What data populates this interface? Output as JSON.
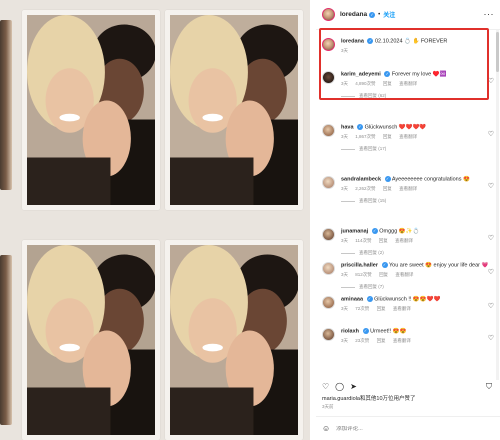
{
  "post": {
    "username": "loredana",
    "follow_label": "关注",
    "more_label": "···"
  },
  "caption": {
    "username": "loredana",
    "date": "02.10.2024",
    "text": "💍 ✋ FOREVER",
    "time": "3天"
  },
  "comments": [
    {
      "username": "karim_adeyemi",
      "text": "Forever my love ♥️♾️",
      "time": "3天",
      "likes": "4,890次赞",
      "reply": "回复",
      "translate": "查看翻译",
      "view_replies": "查看回复 (62)",
      "avatar": "b"
    },
    {
      "username": "hava",
      "text": "Glückwunsch ❤️❤️❤️❤️",
      "time": "3天",
      "likes": "1,867次赞",
      "reply": "回复",
      "translate": "查看翻译",
      "view_replies": "查看回复 (17)",
      "avatar": "c"
    },
    {
      "username": "sandralambeck",
      "text": "Ayeeeeeeee congratulations 😍",
      "time": "3天",
      "likes": "2,262次赞",
      "reply": "回复",
      "translate": "查看翻译",
      "view_replies": "查看回复 (15)",
      "avatar": "d"
    },
    {
      "username": "junamanaj",
      "text": "Omggg 😍✨💍",
      "time": "3天",
      "likes": "114次赞",
      "reply": "回复",
      "translate": "查看翻译",
      "view_replies": "查看回复 (2)",
      "avatar": "e"
    },
    {
      "username": "priscilla.haller",
      "text": "You are sweet 😍 enjoy your life dear 💗",
      "time": "3天",
      "likes": "812次赞",
      "reply": "回复",
      "translate": "查看翻译",
      "view_replies": "查看回复 (7)",
      "avatar": "d"
    },
    {
      "username": "aminaaa",
      "text": "Glückwunsch !! 😍😍❤️❤️",
      "time": "3天",
      "likes": "72次赞",
      "reply": "回复",
      "translate": "查看翻译",
      "view_replies": "",
      "avatar": "c"
    },
    {
      "username": "riolaxh",
      "text": "Urmeet!! 😍😍",
      "time": "3天",
      "likes": "23次赞",
      "reply": "回复",
      "translate": "查看翻译",
      "view_replies": "",
      "avatar": "e"
    }
  ],
  "footer": {
    "liked_by": "maria.guardiola和其他10万位用户赞了",
    "date": "3天前",
    "add_comment_placeholder": "添加评论..."
  },
  "icons": {
    "heart": "♡",
    "comment": "◯",
    "share": "➤",
    "bookmark": "⛉",
    "emoji": "☺"
  }
}
